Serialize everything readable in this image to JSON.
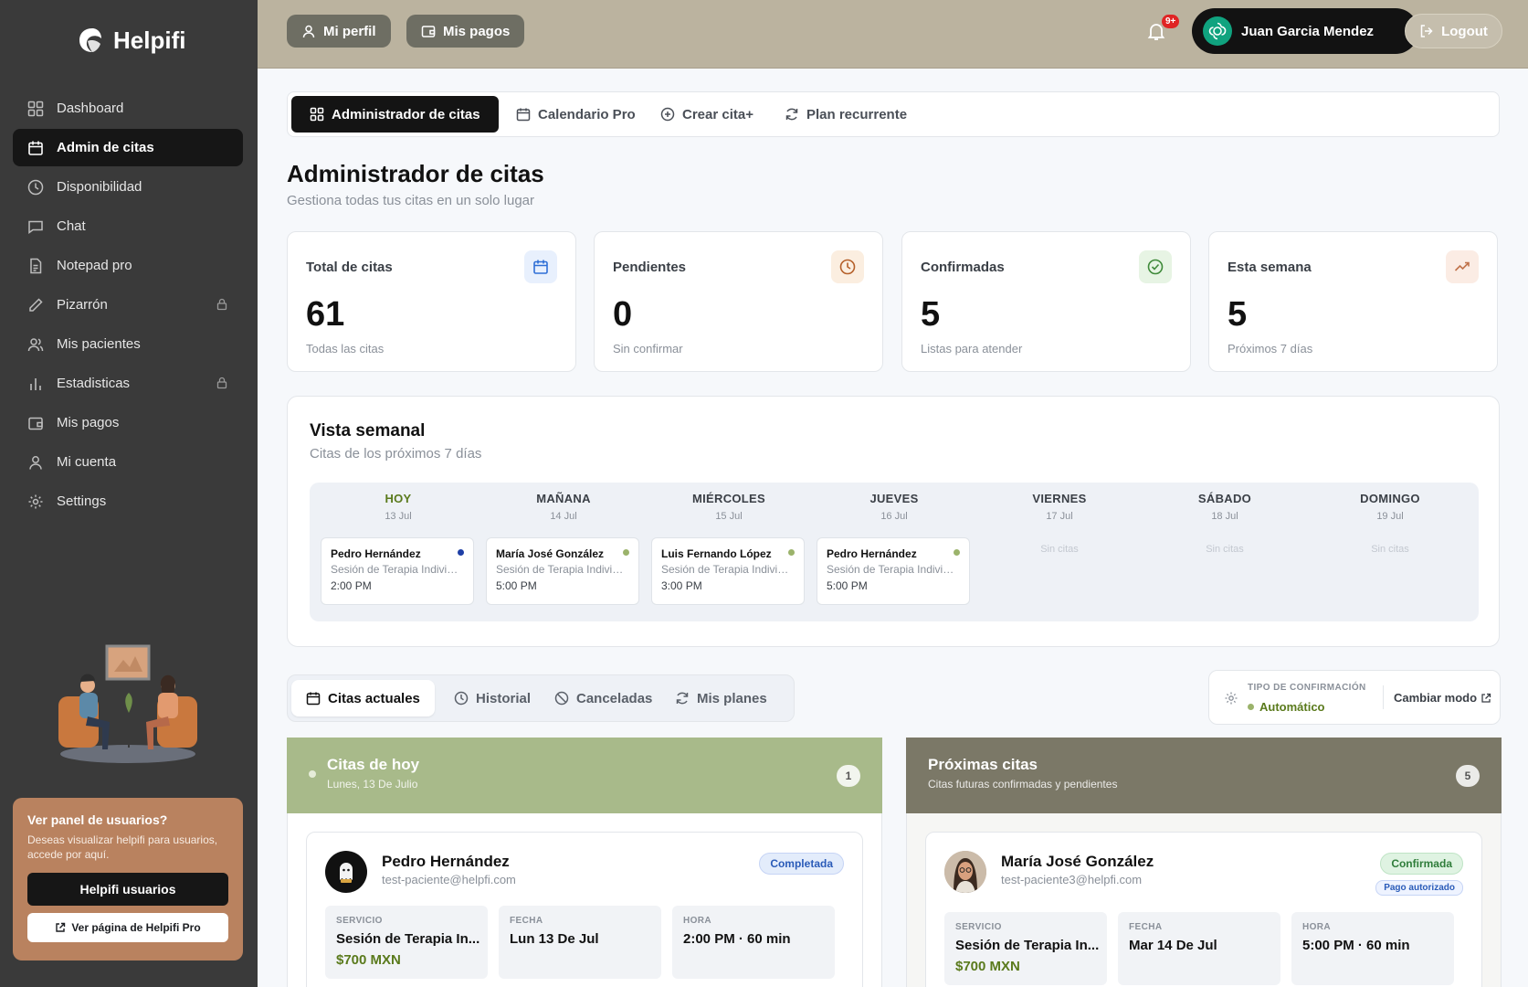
{
  "brand": {
    "name": "Helpifi"
  },
  "sidebar": {
    "items": [
      {
        "label": "Dashboard",
        "icon": "grid-icon"
      },
      {
        "label": "Admin de citas",
        "icon": "calendar-icon",
        "active": true
      },
      {
        "label": "Disponibilidad",
        "icon": "clock-icon"
      },
      {
        "label": "Chat",
        "icon": "chat-icon"
      },
      {
        "label": "Notepad pro",
        "icon": "notepad-icon"
      },
      {
        "label": "Pizarrón",
        "icon": "pencil-icon",
        "locked": true
      },
      {
        "label": "Mis pacientes",
        "icon": "users-icon"
      },
      {
        "label": "Estadisticas",
        "icon": "bar-chart-icon",
        "locked": true
      },
      {
        "label": "Mis pagos",
        "icon": "wallet-icon"
      },
      {
        "label": "Mi cuenta",
        "icon": "user-icon"
      },
      {
        "label": "Settings",
        "icon": "gear-icon"
      }
    ],
    "promo": {
      "title": "Ver panel de usuarios?",
      "text": "Deseas visualizar helpifi para usuarios, accede por aquí.",
      "button": "Helpifi usuarios",
      "link": "Ver página de Helpifi Pro"
    }
  },
  "topbar": {
    "profile": "Mi perfil",
    "payments": "Mis pagos",
    "notifications": "9+",
    "user": "Juan Garcia Mendez",
    "logout": "Logout"
  },
  "tabs": [
    {
      "label": "Administrador de citas",
      "icon": "grid-icon",
      "active": true
    },
    {
      "label": "Calendario Pro",
      "icon": "calendar-icon"
    },
    {
      "label": "Crear cita+",
      "icon": "plus-circle-icon"
    },
    {
      "label": "Plan recurrente",
      "icon": "refresh-icon"
    }
  ],
  "page": {
    "title": "Administrador de citas",
    "subtitle": "Gestiona todas tus citas en un solo lugar"
  },
  "stats": [
    {
      "label": "Total de citas",
      "value": "61",
      "sub": "Todas las citas",
      "icon": "calendar-icon",
      "color": "#2f6fd6",
      "bg": "#e8f0fd"
    },
    {
      "label": "Pendientes",
      "value": "0",
      "sub": "Sin confirmar",
      "icon": "clock-icon",
      "color": "#b5602a",
      "bg": "#fbeee0"
    },
    {
      "label": "Confirmadas",
      "value": "5",
      "sub": "Listas para atender",
      "icon": "check-circle-icon",
      "color": "#3f8a3a",
      "bg": "#e7f4e4"
    },
    {
      "label": "Esta semana",
      "value": "5",
      "sub": "Próximos 7 días",
      "icon": "trending-up-icon",
      "color": "#c0724a",
      "bg": "#fbece4"
    }
  ],
  "week": {
    "title": "Vista semanal",
    "subtitle": "Citas de los próximos 7 días",
    "days": [
      {
        "name": "HOY",
        "date": "13 Jul",
        "today": true,
        "appt": {
          "name": "Pedro Hernández",
          "service": "Sesión de Terapia Individual",
          "time": "2:00 PM",
          "dot": "#1e3fa6"
        }
      },
      {
        "name": "MAÑANA",
        "date": "14 Jul",
        "appt": {
          "name": "María José González",
          "service": "Sesión de Terapia Individual",
          "time": "5:00 PM",
          "dot": "#9bb36b"
        }
      },
      {
        "name": "MIÉRCOLES",
        "date": "15 Jul",
        "appt": {
          "name": "Luis Fernando López",
          "service": "Sesión de Terapia Individual",
          "time": "3:00 PM",
          "dot": "#9bb36b"
        }
      },
      {
        "name": "JUEVES",
        "date": "16 Jul",
        "appt": {
          "name": "Pedro Hernández",
          "service": "Sesión de Terapia Individual",
          "time": "5:00 PM",
          "dot": "#9bb36b"
        }
      },
      {
        "name": "VIERNES",
        "date": "17 Jul",
        "empty": "Sin citas"
      },
      {
        "name": "SÁBADO",
        "date": "18 Jul",
        "empty": "Sin citas"
      },
      {
        "name": "DOMINGO",
        "date": "19 Jul",
        "empty": "Sin citas"
      }
    ]
  },
  "subtabs": [
    {
      "label": "Citas actuales",
      "icon": "calendar-icon",
      "active": true
    },
    {
      "label": "Historial",
      "icon": "clock-icon"
    },
    {
      "label": "Canceladas",
      "icon": "ban-icon"
    },
    {
      "label": "Mis planes",
      "icon": "refresh-icon"
    }
  ],
  "confirmation": {
    "label": "TIPO DE CONFIRMACIÓN",
    "value": "Automático",
    "change": "Cambiar modo"
  },
  "today_panel": {
    "title": "Citas de hoy",
    "subtitle": "Lunes, 13 De Julio",
    "count": "1",
    "color": "#a8ba8a",
    "card": {
      "name": "Pedro Hernández",
      "email": "test-paciente@helpfi.com",
      "status": "Completada",
      "service_label": "SERVICIO",
      "service": "Sesión de Terapia In...",
      "price": "$700 MXN",
      "date_label": "FECHA",
      "date": "Lun 13 De Jul",
      "time_label": "HORA",
      "time": "2:00 PM · 60 min"
    }
  },
  "upcoming_panel": {
    "title": "Próximas citas",
    "subtitle": "Citas futuras confirmadas y pendientes",
    "count": "5",
    "color": "#7b7867",
    "card": {
      "name": "María José González",
      "email": "test-paciente3@helpfi.com",
      "status": "Confirmada",
      "payment": "Pago autorizado",
      "service_label": "SERVICIO",
      "service": "Sesión de Terapia In...",
      "price": "$700 MXN",
      "date_label": "FECHA",
      "date": "Mar 14 De Jul",
      "time_label": "HORA",
      "time": "5:00 PM · 60 min"
    }
  }
}
